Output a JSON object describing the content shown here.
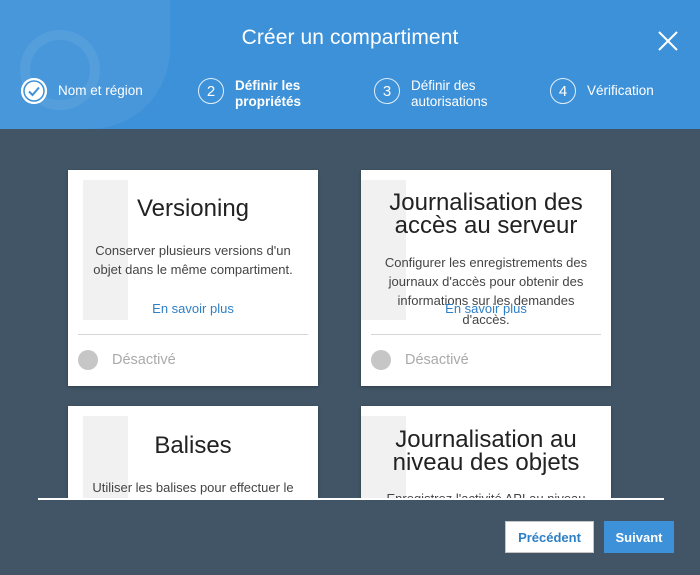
{
  "dialog": {
    "title": "Créer un compartiment"
  },
  "steps": [
    {
      "number": "",
      "label": "Nom et région"
    },
    {
      "number": "2",
      "label_line1": "Définir les",
      "label_line2": "propriétés"
    },
    {
      "number": "3",
      "label_line1": "Définir des",
      "label_line2": "autorisations"
    },
    {
      "number": "4",
      "label": "Vérification"
    }
  ],
  "cards": [
    {
      "title": "Versioning",
      "description": "Conserver plusieurs versions d'un objet dans le même compartiment.",
      "link": "En savoir plus",
      "status": "Désactivé"
    },
    {
      "title_line1": "Journalisation des",
      "title_line2": "accès au serveur",
      "description": "Configurer les enregistrements des journaux d'accès pour obtenir des informations sur les demandes d'accès.",
      "link": "En savoir plus",
      "status": "Désactivé"
    },
    {
      "title": "Balises",
      "description": "Utiliser les balises pour effectuer le"
    },
    {
      "title_line1": "Journalisation au",
      "title_line2": "niveau des objets",
      "description": "Enregistrez l'activité API au niveau des"
    }
  ],
  "footer": {
    "prev_label": "Précédent",
    "next_label": "Suivant"
  },
  "colors": {
    "header": "#3c91d8",
    "content_bg": "#415566",
    "link": "#2d7fc6"
  },
  "icons": {
    "close": "close-icon",
    "step_done": "check-circle-icon"
  }
}
